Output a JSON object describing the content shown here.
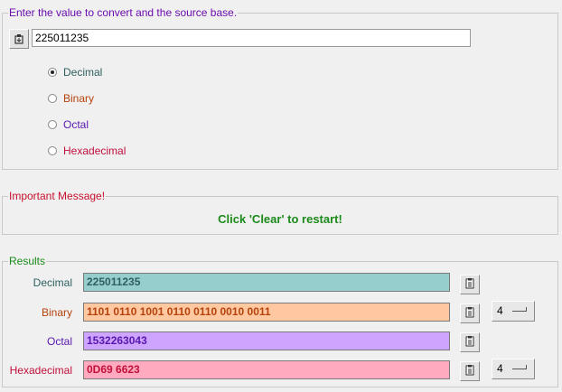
{
  "input_group": {
    "legend": "Enter the value to convert and the source base.",
    "value": "225011235",
    "paste_icon": "paste-icon",
    "radios": [
      {
        "label": "Decimal",
        "checked": true,
        "color": "#2f6060"
      },
      {
        "label": "Binary",
        "checked": false,
        "color": "#b5420c"
      },
      {
        "label": "Octal",
        "checked": false,
        "color": "#5a17b0"
      },
      {
        "label": "Hexadecimal",
        "checked": false,
        "color": "#c0103c"
      }
    ]
  },
  "message_group": {
    "legend": "Important Message!",
    "text": "Click 'Clear' to restart!"
  },
  "results_group": {
    "legend": "Results",
    "rows": [
      {
        "label": "Decimal",
        "value": "225011235",
        "bg": "#96cdcd",
        "color": "#2f6060",
        "has_group_select": false
      },
      {
        "label": "Binary",
        "value": "1101 0110 1001 0110 0110 0010 0011",
        "bg": "#ffc8a0",
        "color": "#b5420c",
        "has_group_select": true,
        "group_size": "4"
      },
      {
        "label": "Octal",
        "value": "1532263043",
        "bg": "#cda5ff",
        "color": "#5a17b0",
        "has_group_select": false
      },
      {
        "label": "Hexadecimal",
        "value": "0D69 6623",
        "bg": "#ffaabe",
        "color": "#c0103c",
        "has_group_select": true,
        "group_size": "4"
      }
    ],
    "copy_icon": "clipboard-icon"
  },
  "colors": {
    "input_legend": "#6a0dad",
    "message_legend": "#c8102e",
    "message_text": "#1b8a1b",
    "results_legend": "#1b8a1b"
  }
}
